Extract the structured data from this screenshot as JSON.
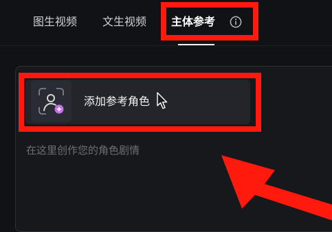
{
  "tabs": [
    {
      "label": "图生视频",
      "active": false
    },
    {
      "label": "文生视频",
      "active": false
    },
    {
      "label": "主体参考",
      "active": true
    }
  ],
  "tab_info_icon": "info-circle-icon",
  "add_role": {
    "label": "添加参考角色",
    "icon": "person-add-icon"
  },
  "editor": {
    "placeholder": "在这里创作您的角色剧情"
  },
  "colors": {
    "background": "#111216",
    "annotation_red": "#ff1a0d",
    "badge_purple": "#c86ee6"
  }
}
